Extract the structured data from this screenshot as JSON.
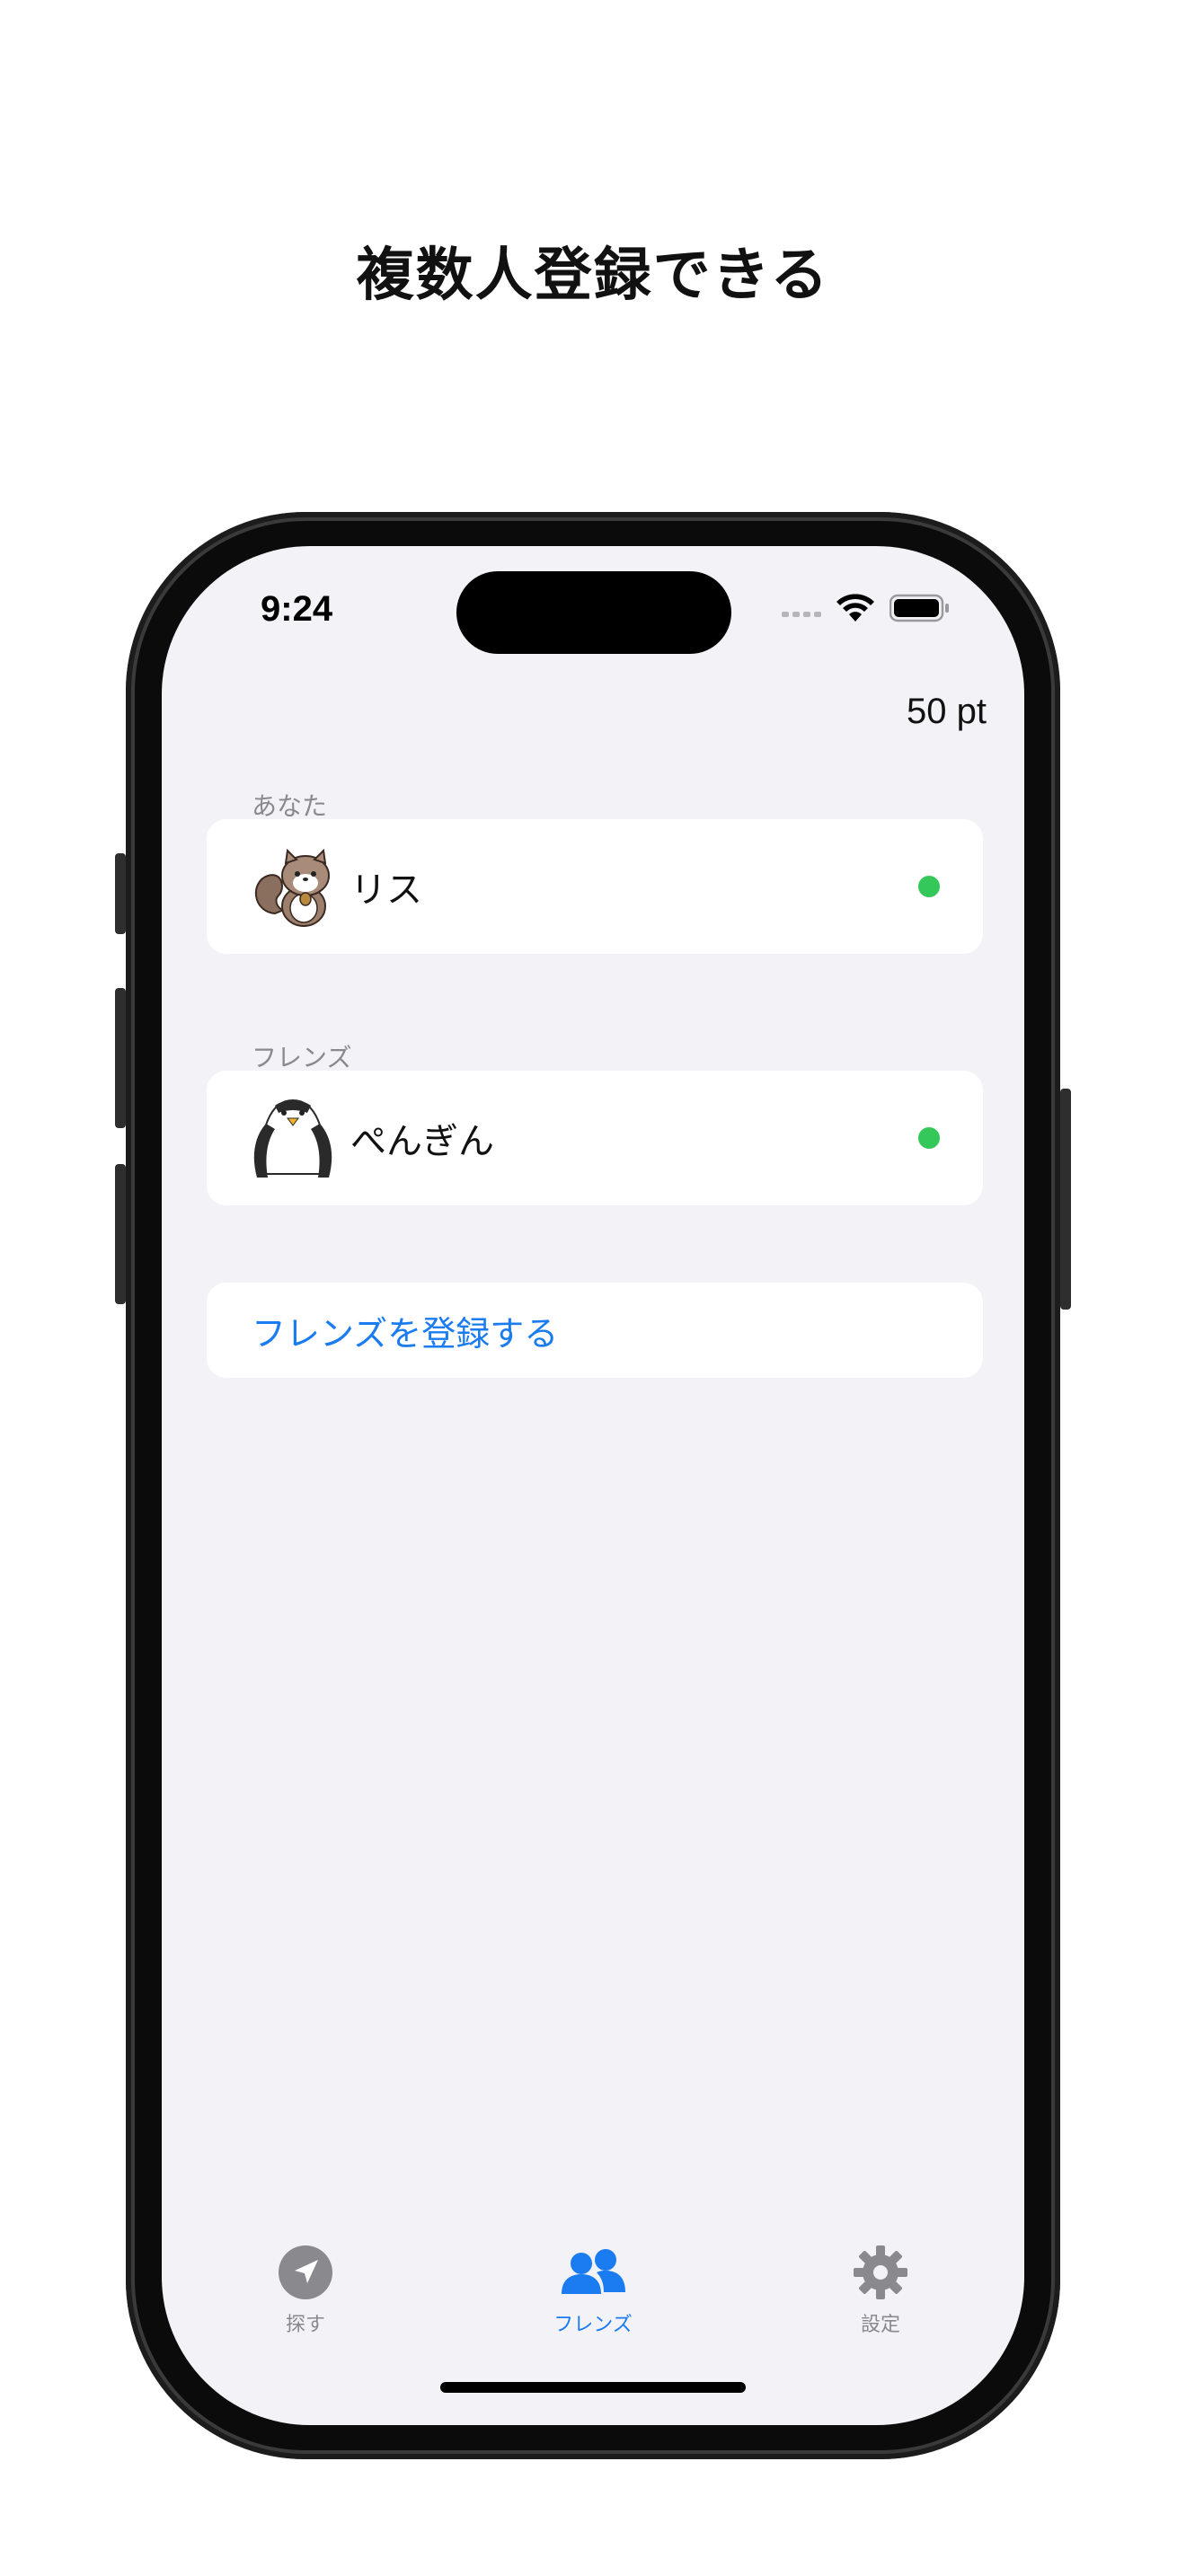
{
  "headline": "複数人登録できる",
  "status_bar": {
    "time": "9:24",
    "icons": [
      "cellular-signal-icon",
      "wifi-icon",
      "battery-icon"
    ]
  },
  "points": "50 pt",
  "you_section": {
    "label": "あなた",
    "items": [
      {
        "name": "リス",
        "avatar": "squirrel-avatar",
        "status": "online"
      }
    ]
  },
  "friends_section": {
    "label": "フレンズ",
    "items": [
      {
        "name": "ぺんぎん",
        "avatar": "penguin-avatar",
        "status": "online"
      }
    ]
  },
  "register_button": {
    "label": "フレンズを登録する"
  },
  "tabbar": {
    "tabs": [
      {
        "label": "探す",
        "icon": "location-arrow-icon",
        "active": false
      },
      {
        "label": "フレンズ",
        "icon": "people-icon",
        "active": true
      },
      {
        "label": "設定",
        "icon": "gear-icon",
        "active": false
      }
    ]
  },
  "colors": {
    "accent": "#1a7cf0",
    "online": "#34c759",
    "background": "#f2f2f7",
    "secondary_text": "#8a8a8e"
  }
}
